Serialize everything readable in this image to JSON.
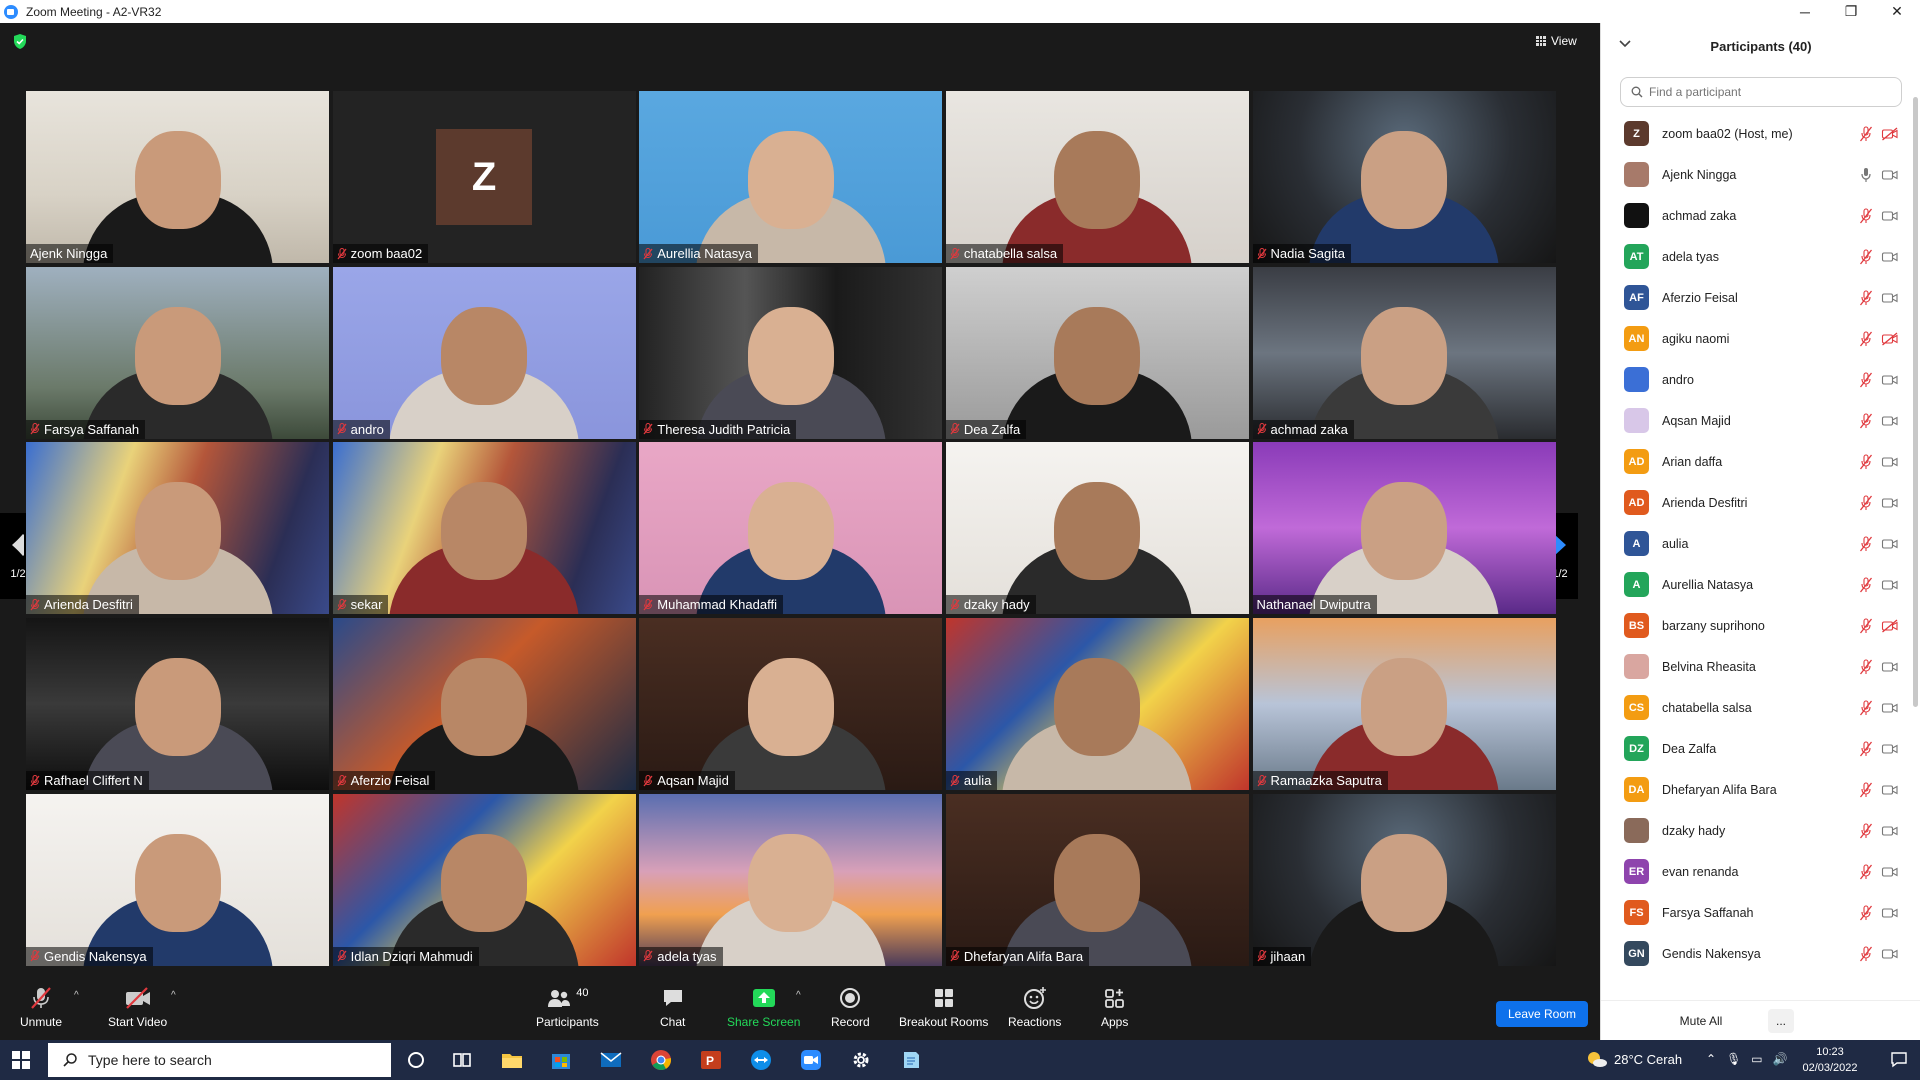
{
  "window": {
    "title": "Zoom Meeting - A2-VR32",
    "minimize": "─",
    "maximize": "❐",
    "close": "✕"
  },
  "view_button": "View",
  "page_indicator": "1/2",
  "tiles": [
    {
      "name": "Ajenk Ningga",
      "muted": false,
      "scene": "room"
    },
    {
      "name": "zoom baa02",
      "muted": true,
      "scene": "avatar",
      "initial": "Z"
    },
    {
      "name": "Aurellia Natasya",
      "muted": true,
      "scene": "blue"
    },
    {
      "name": "chatabella salsa",
      "muted": true,
      "scene": "light"
    },
    {
      "name": "Nadia Sagita",
      "muted": true,
      "scene": "dark-window"
    },
    {
      "name": "Farsya Saffanah",
      "muted": true,
      "scene": "sky"
    },
    {
      "name": "andro",
      "muted": true,
      "scene": "periwinkle"
    },
    {
      "name": "Theresa Judith Patricia",
      "muted": true,
      "scene": "comic-dark"
    },
    {
      "name": "Dea Zalfa",
      "muted": true,
      "scene": "grey"
    },
    {
      "name": "achmad zaka",
      "muted": true,
      "scene": "dim"
    },
    {
      "name": "Arienda Desfitri",
      "muted": true,
      "scene": "cosmic"
    },
    {
      "name": "sekar",
      "muted": true,
      "scene": "cosmic"
    },
    {
      "name": "Muhammad Khadaffi",
      "muted": true,
      "scene": "pink"
    },
    {
      "name": "dzaky hady",
      "muted": true,
      "scene": "white-wall"
    },
    {
      "name": "Nathanael Dwiputra",
      "muted": false,
      "scene": "purple"
    },
    {
      "name": "Rafhael Cliffert N",
      "muted": true,
      "scene": "band"
    },
    {
      "name": "Aferzio Feisal",
      "muted": true,
      "scene": "movie"
    },
    {
      "name": "Aqsan Majid",
      "muted": true,
      "scene": "warm-dark"
    },
    {
      "name": "aulia",
      "muted": true,
      "scene": "comics"
    },
    {
      "name": "Ramaazka Saputra",
      "muted": true,
      "scene": "bridge"
    },
    {
      "name": "Gendis Nakensya",
      "muted": true,
      "scene": "white-wall"
    },
    {
      "name": "Idlan Dziqri Mahmudi",
      "muted": true,
      "scene": "comics"
    },
    {
      "name": "adela tyas",
      "muted": true,
      "scene": "sunset"
    },
    {
      "name": "Dhefaryan Alifa Bara",
      "muted": true,
      "scene": "warm-dark"
    },
    {
      "name": "jihaan",
      "muted": true,
      "scene": "dark-window"
    }
  ],
  "toolbar": {
    "unmute": "Unmute",
    "start_video": "Start Video",
    "participants": "Participants",
    "participants_count": "40",
    "chat": "Chat",
    "share_screen": "Share Screen",
    "record": "Record",
    "breakout_rooms": "Breakout Rooms",
    "reactions": "Reactions",
    "apps": "Apps",
    "leave_room": "Leave Room"
  },
  "panel": {
    "title": "Participants (40)",
    "search_placeholder": "Find a participant",
    "mute_all": "Mute All",
    "more": "...",
    "participants": [
      {
        "name": "zoom baa02 (Host, me)",
        "initials": "Z",
        "color": "#5c3a2d",
        "mic": "muted",
        "video": "off"
      },
      {
        "name": "Ajenk Ningga",
        "initials": "",
        "color": "#a77a6a",
        "mic": "on",
        "video": "on"
      },
      {
        "name": "achmad zaka",
        "initials": "",
        "color": "#111111",
        "mic": "muted",
        "video": "on"
      },
      {
        "name": "adela tyas",
        "initials": "AT",
        "color": "#23a55a",
        "mic": "muted",
        "video": "on"
      },
      {
        "name": "Aferzio Feisal",
        "initials": "AF",
        "color": "#2f5597",
        "mic": "muted",
        "video": "on"
      },
      {
        "name": "agiku naomi",
        "initials": "AN",
        "color": "#f39c12",
        "mic": "muted",
        "video": "off"
      },
      {
        "name": "andro",
        "initials": "",
        "color": "#3b6fd6",
        "mic": "muted",
        "video": "on"
      },
      {
        "name": "Aqsan Majid",
        "initials": "",
        "color": "#d8c7e8",
        "mic": "muted",
        "video": "on"
      },
      {
        "name": "Arian daffa",
        "initials": "AD",
        "color": "#f39c12",
        "mic": "muted",
        "video": "on"
      },
      {
        "name": "Arienda Desfitri",
        "initials": "AD",
        "color": "#e05a1e",
        "mic": "muted",
        "video": "on"
      },
      {
        "name": "aulia",
        "initials": "A",
        "color": "#2f5597",
        "mic": "muted",
        "video": "on"
      },
      {
        "name": "Aurellia Natasya",
        "initials": "A",
        "color": "#23a55a",
        "mic": "muted",
        "video": "on"
      },
      {
        "name": "barzany suprihono",
        "initials": "BS",
        "color": "#e05a1e",
        "mic": "muted",
        "video": "off"
      },
      {
        "name": "Belvina Rheasita",
        "initials": "",
        "color": "#d9a6a0",
        "mic": "muted",
        "video": "on"
      },
      {
        "name": "chatabella salsa",
        "initials": "CS",
        "color": "#f39c12",
        "mic": "muted",
        "video": "on"
      },
      {
        "name": "Dea Zalfa",
        "initials": "DZ",
        "color": "#23a55a",
        "mic": "muted",
        "video": "on"
      },
      {
        "name": "Dhefaryan Alifa Bara",
        "initials": "DA",
        "color": "#f39c12",
        "mic": "muted",
        "video": "on"
      },
      {
        "name": "dzaky hady",
        "initials": "",
        "color": "#8a6a5a",
        "mic": "muted",
        "video": "on"
      },
      {
        "name": "evan renanda",
        "initials": "ER",
        "color": "#8e44ad",
        "mic": "muted",
        "video": "on"
      },
      {
        "name": "Farsya Saffanah",
        "initials": "FS",
        "color": "#e05a1e",
        "mic": "muted",
        "video": "on"
      },
      {
        "name": "Gendis Nakensya",
        "initials": "GN",
        "color": "#34495e",
        "mic": "muted",
        "video": "on"
      }
    ]
  },
  "taskbar": {
    "search_placeholder": "Type here to search",
    "weather": "28°C  Cerah",
    "time": "10:23",
    "date": "02/03/2022"
  },
  "colors": {
    "accent": "#0e71eb",
    "muted_red": "#e0393e",
    "active_speaker": "#f2f06b",
    "share_green": "#23d959"
  }
}
